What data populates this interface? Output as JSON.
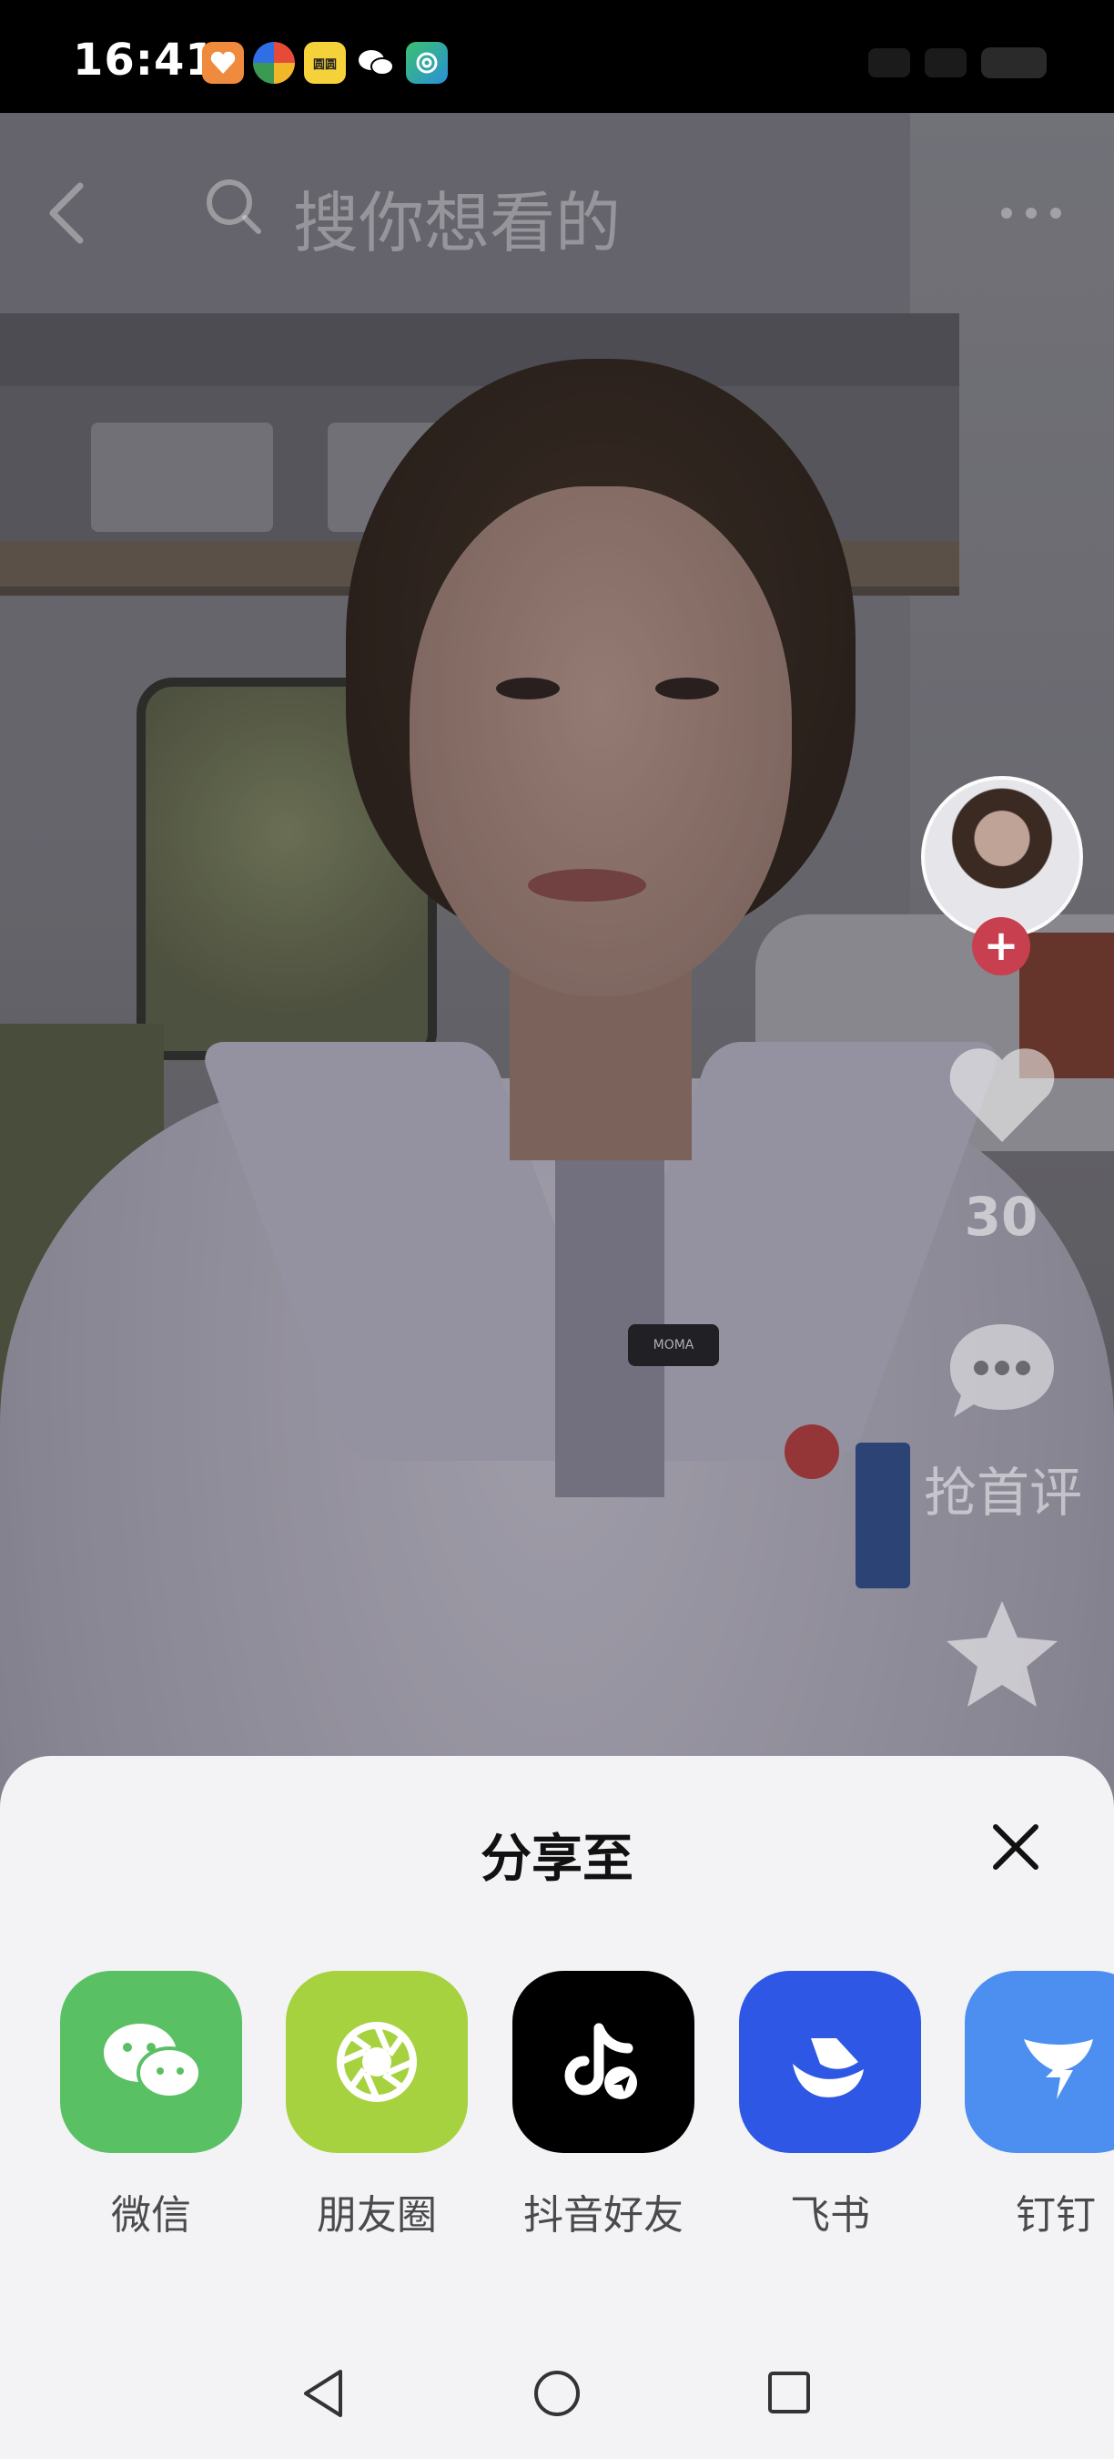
{
  "status_bar": {
    "time": "16:41",
    "notification_icons": [
      "health-app-icon",
      "photos-app-icon",
      "game-app-icon",
      "wechat-icon",
      "fingerprint-app-icon"
    ],
    "notification_labels": [
      "",
      "",
      "圆圆",
      "",
      ""
    ]
  },
  "video": {
    "search_placeholder": "搜你想看的",
    "mic_brand": "MOMA",
    "like_count": "30",
    "comment_label": "抢首评"
  },
  "share_sheet": {
    "title": "分享至",
    "targets": [
      {
        "label": "微信",
        "icon": "wechat-icon",
        "color": "#5ac064"
      },
      {
        "label": "朋友圈",
        "icon": "moments-icon",
        "color": "#a6d23f"
      },
      {
        "label": "抖音好友",
        "icon": "douyin-icon",
        "color": "#000000"
      },
      {
        "label": "飞书",
        "icon": "feishu-icon",
        "color": "#2f57e5"
      },
      {
        "label": "钉钉",
        "icon": "dingtalk-icon",
        "color": "#4d8ff0"
      }
    ]
  },
  "colors": {
    "sheet_background": "#f3f3f5",
    "follow_badge": "#c8404f"
  }
}
